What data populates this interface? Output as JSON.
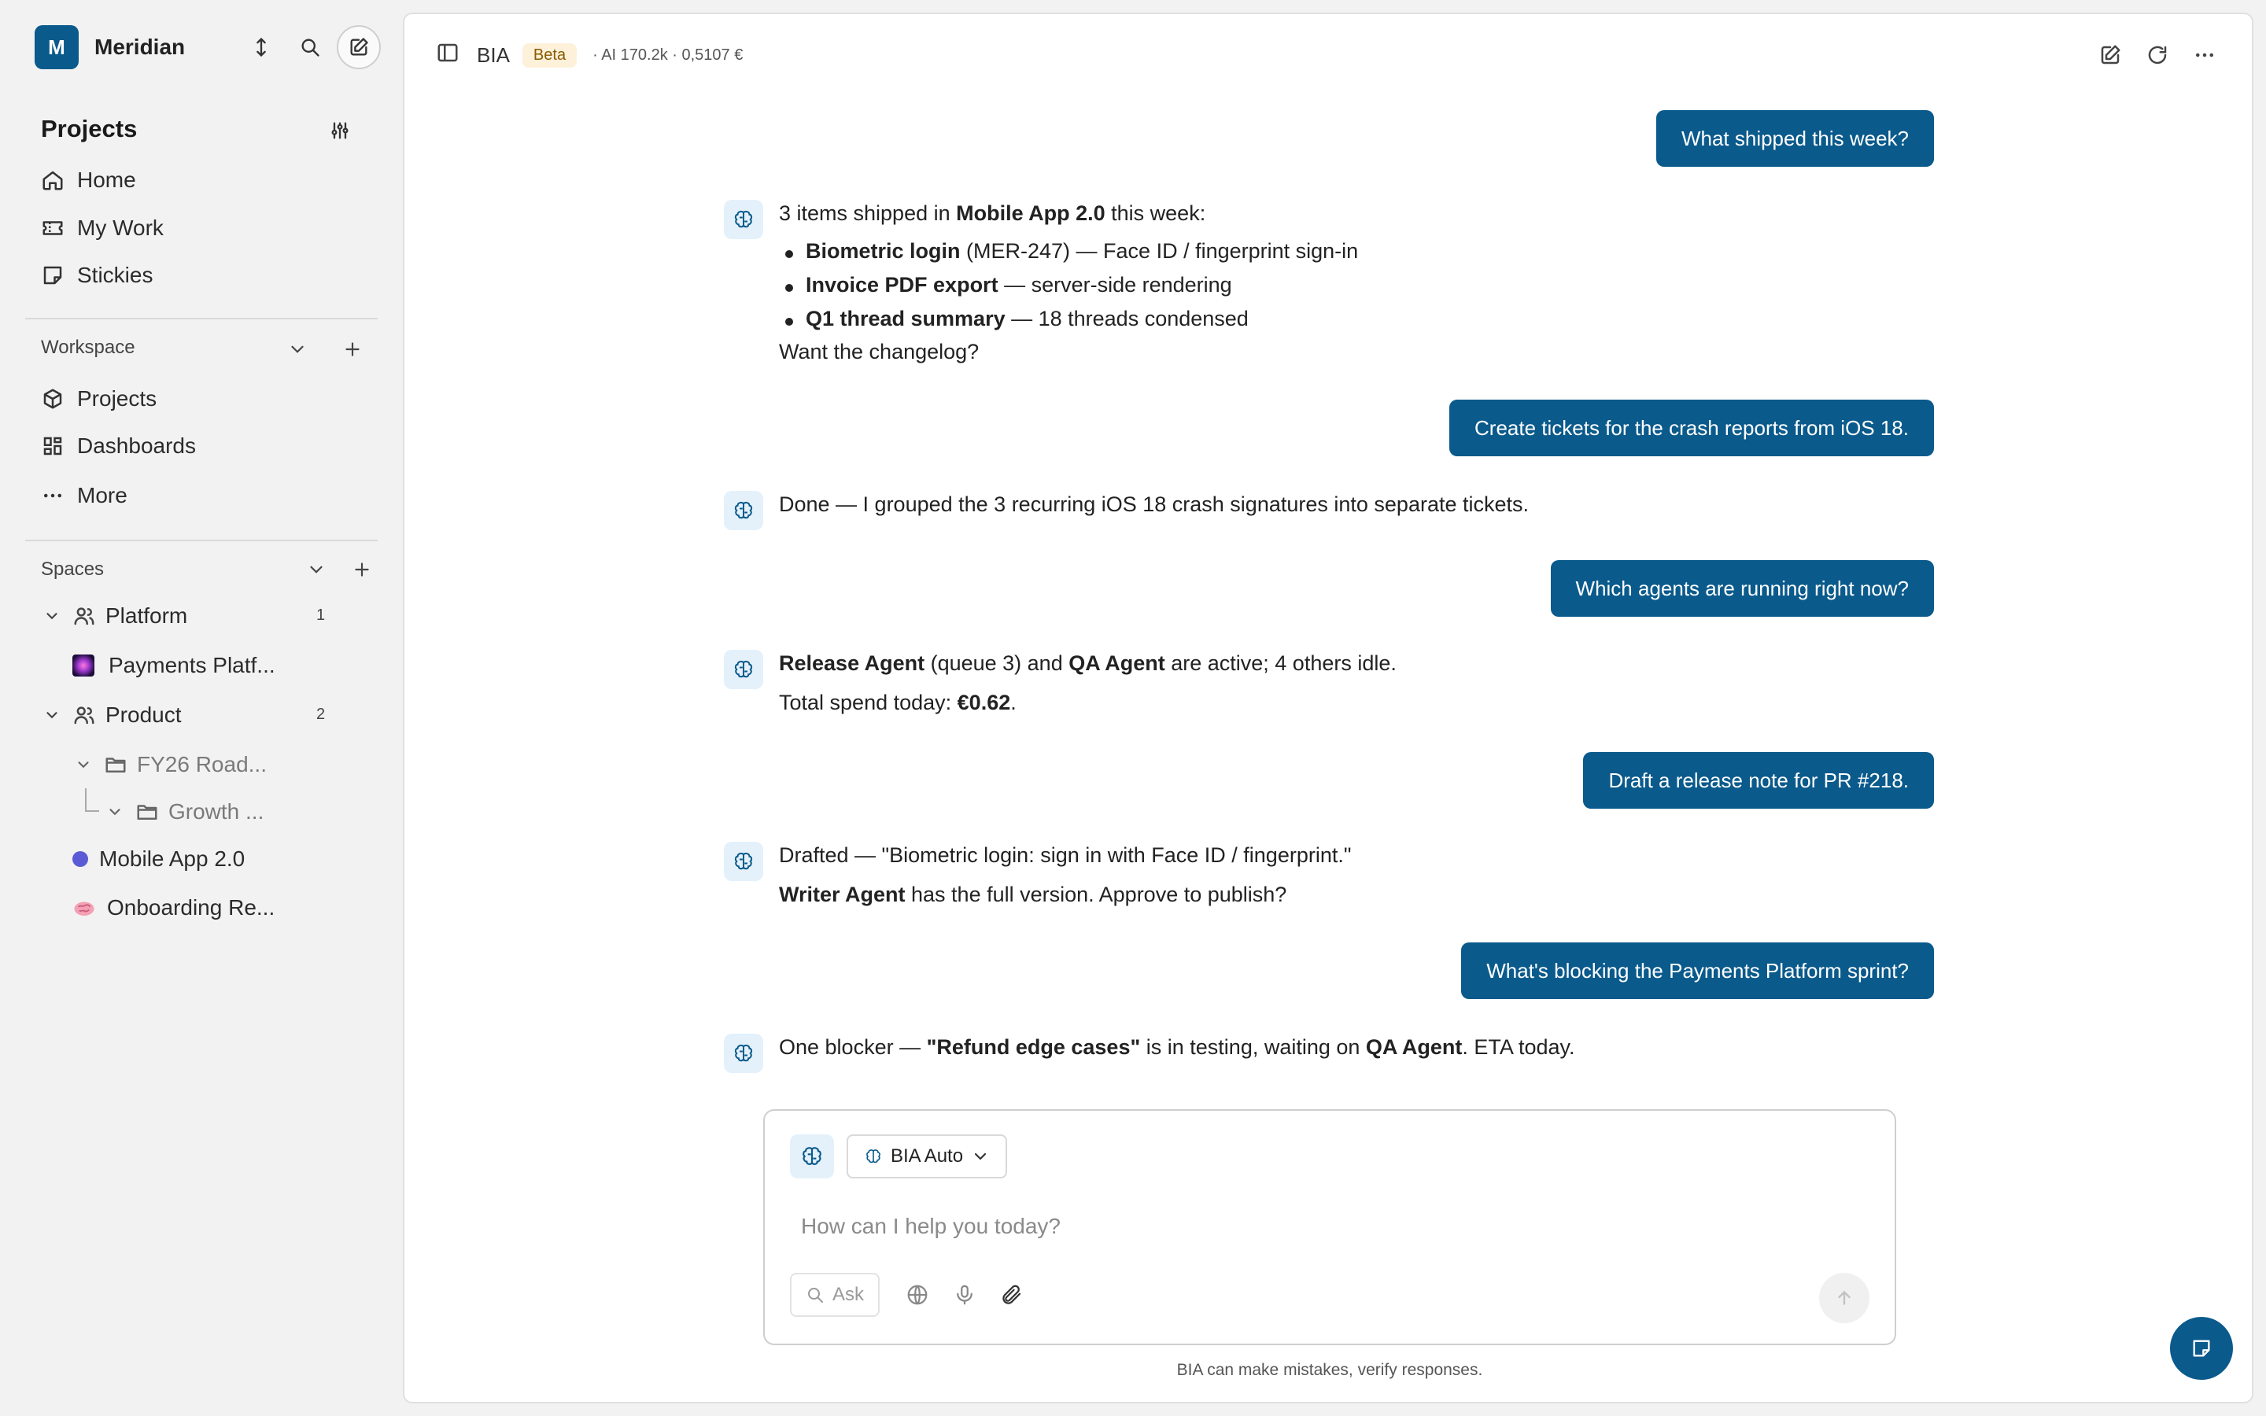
{
  "workspace": {
    "initial": "M",
    "name": "Meridian"
  },
  "sidebar": {
    "projects_title": "Projects",
    "nav": [
      {
        "label": "Home",
        "icon": "home-icon"
      },
      {
        "label": "My Work",
        "icon": "ticket-icon"
      },
      {
        "label": "Stickies",
        "icon": "sticky-note-icon"
      }
    ],
    "workspace_label": "Workspace",
    "workspace_items": [
      {
        "label": "Projects",
        "icon": "box-icon"
      },
      {
        "label": "Dashboards",
        "icon": "grid-icon"
      },
      {
        "label": "More",
        "icon": "dots-icon"
      }
    ],
    "spaces_label": "Spaces",
    "spaces": {
      "platform": {
        "label": "Platform",
        "count": "1"
      },
      "payments": {
        "label": "Payments Platf..."
      },
      "product": {
        "label": "Product",
        "count": "2"
      },
      "fy26": {
        "label": "FY26 Road..."
      },
      "growth": {
        "label": "Growth ..."
      },
      "mobile": {
        "label": "Mobile App 2.0"
      },
      "onboarding": {
        "label": "Onboarding Re..."
      }
    }
  },
  "topbar": {
    "title": "BIA",
    "badge": "Beta",
    "meta": "· AI 170.2k · 0,5107 €"
  },
  "chat": {
    "u1": "What shipped this week?",
    "b1": {
      "pre": "3 items shipped in ",
      "strong": "Mobile App 2.0",
      "post": " this week:",
      "bullets": [
        {
          "strong": "Biometric login",
          "rest": " (MER-247) — Face ID / fingerprint sign-in"
        },
        {
          "strong": "Invoice PDF export",
          "rest": " — server-side rendering"
        },
        {
          "strong": "Q1 thread summary",
          "rest": " — 18 threads condensed"
        }
      ],
      "outro": "Want the changelog?"
    },
    "u2": "Create tickets for the crash reports from iOS 18.",
    "b2": "Done — I grouped the 3 recurring iOS 18 crash signatures into separate tickets.",
    "u3": "Which agents are running right now?",
    "b3": {
      "s1": "Release Agent",
      "t1": " (queue 3) and ",
      "s2": "QA Agent",
      "t2": " are active; 4 others idle.",
      "l2pre": "Total spend today: ",
      "l2strong": "€0.62",
      "l2post": "."
    },
    "u4": "Draft a release note for PR #218.",
    "b4": {
      "line1": "Drafted — \"Biometric login: sign in with Face ID / fingerprint.\"",
      "s": "Writer Agent",
      "rest": " has the full version. Approve to publish?"
    },
    "u5": "What's blocking the Payments Platform sprint?",
    "b5": {
      "pre": "One blocker — ",
      "s1": "\"Refund edge cases\"",
      "mid": " is in testing, waiting on ",
      "s2": "QA Agent",
      "post": ". ETA today."
    }
  },
  "composer": {
    "model": "BIA Auto",
    "placeholder": "How can I help you today?",
    "ask": "Ask"
  },
  "disclaimer": "BIA can make mistakes, verify responses.",
  "colors": {
    "accent": "#0a5a8c",
    "beta_bg": "#fdf1da",
    "bot_bg": "#e4f1fb"
  }
}
